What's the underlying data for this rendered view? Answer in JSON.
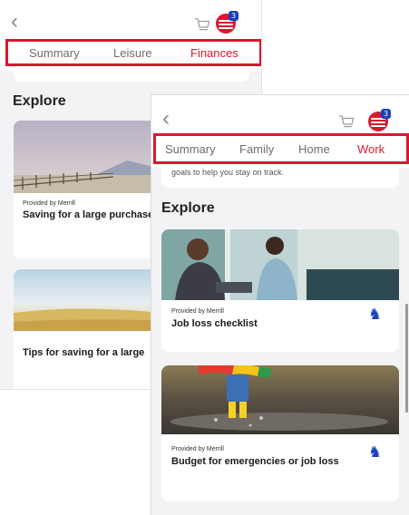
{
  "back_screen": {
    "tabs": [
      {
        "label": "Summary",
        "active": false
      },
      {
        "label": "Leisure",
        "active": false
      },
      {
        "label": "Finances",
        "active": true
      }
    ],
    "notification_count": "3",
    "section_title": "Explore",
    "cards": [
      {
        "provider": "Provided by Merrill",
        "title": "Saving for a large purchase"
      },
      {
        "title": "Tips for saving for a large"
      }
    ]
  },
  "front_screen": {
    "tabs": [
      {
        "label": "Summary",
        "active": false
      },
      {
        "label": "Family",
        "active": false
      },
      {
        "label": "Home",
        "active": false
      },
      {
        "label": "Work",
        "active": true
      }
    ],
    "notification_count": "3",
    "goals_text": "goals to help you stay on track.",
    "section_title": "Explore",
    "cards": [
      {
        "provider": "Provided by Merrill",
        "title": "Job loss checklist"
      },
      {
        "provider": "Provided by Merrill",
        "title": "Budget for emergencies or job loss"
      }
    ]
  },
  "colors": {
    "accent": "#d8182e",
    "badge": "#1b3fb8",
    "background": "#f3f3f5"
  },
  "icons": {
    "back": "chevron-left-icon",
    "cart": "cart-icon",
    "profile": "bank-logo-icon",
    "merrill": "merrill-bull-icon"
  }
}
